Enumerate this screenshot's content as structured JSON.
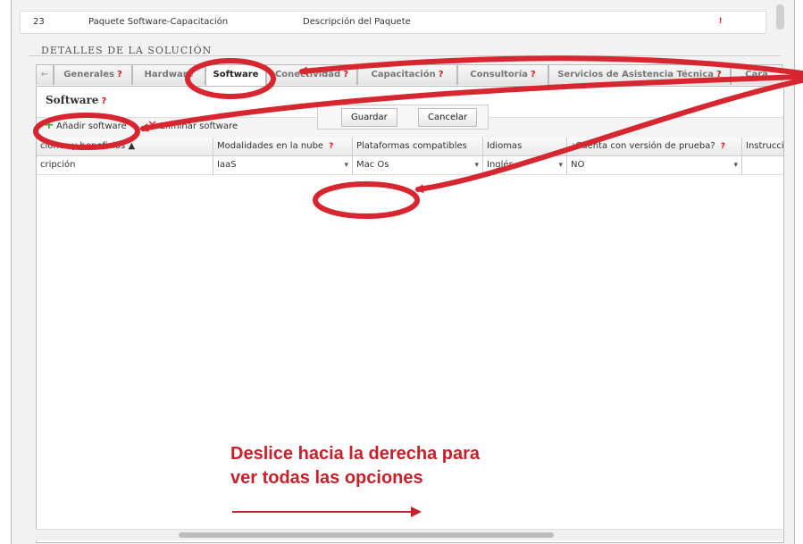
{
  "top_row": {
    "number": "23",
    "name": "Paquete Software-Capacitación",
    "description": "Descripción del Paquete",
    "alert": "!"
  },
  "section_legend": "Detalles de la Solución",
  "tabs": [
    {
      "label": "Generales",
      "badge": "?"
    },
    {
      "label": "Hardware",
      "badge": ""
    },
    {
      "label": "Software",
      "badge": ""
    },
    {
      "label": "Conectividad",
      "badge": "?"
    },
    {
      "label": "Capacitación",
      "badge": "?"
    },
    {
      "label": "Consultoría",
      "badge": "?"
    },
    {
      "label": "Servicios de Asistencia Técnica",
      "badge": "?"
    },
    {
      "label": "Cara",
      "badge": ""
    }
  ],
  "tab_nav_arrow": "←",
  "software_section": {
    "title": "Software",
    "badge": "?"
  },
  "toolbar": {
    "add_label": "Añadir software",
    "delete_label": "Eliminar software"
  },
  "grid": {
    "headers": [
      "ciones y beneficios ▲",
      "Modalidades en la nube",
      "Plataformas compatibles",
      "Idiomas",
      "¿Cuenta con versión de prueba?",
      "Instrucci"
    ],
    "header_badges": [
      "",
      "?",
      "",
      "",
      "?",
      ""
    ],
    "row": [
      "cripción",
      "IaaS",
      "Mac Os",
      "Inglés",
      "NO",
      ""
    ]
  },
  "edit_actions": {
    "save_label": "Guardar",
    "cancel_label": "Cancelar"
  },
  "note": {
    "line1": "Deslice hacia la derecha para",
    "line2": "ver todas las opciones",
    "arrow": "→"
  },
  "colors": {
    "accent_red": "#c8202a",
    "add_green": "#3bab32"
  }
}
